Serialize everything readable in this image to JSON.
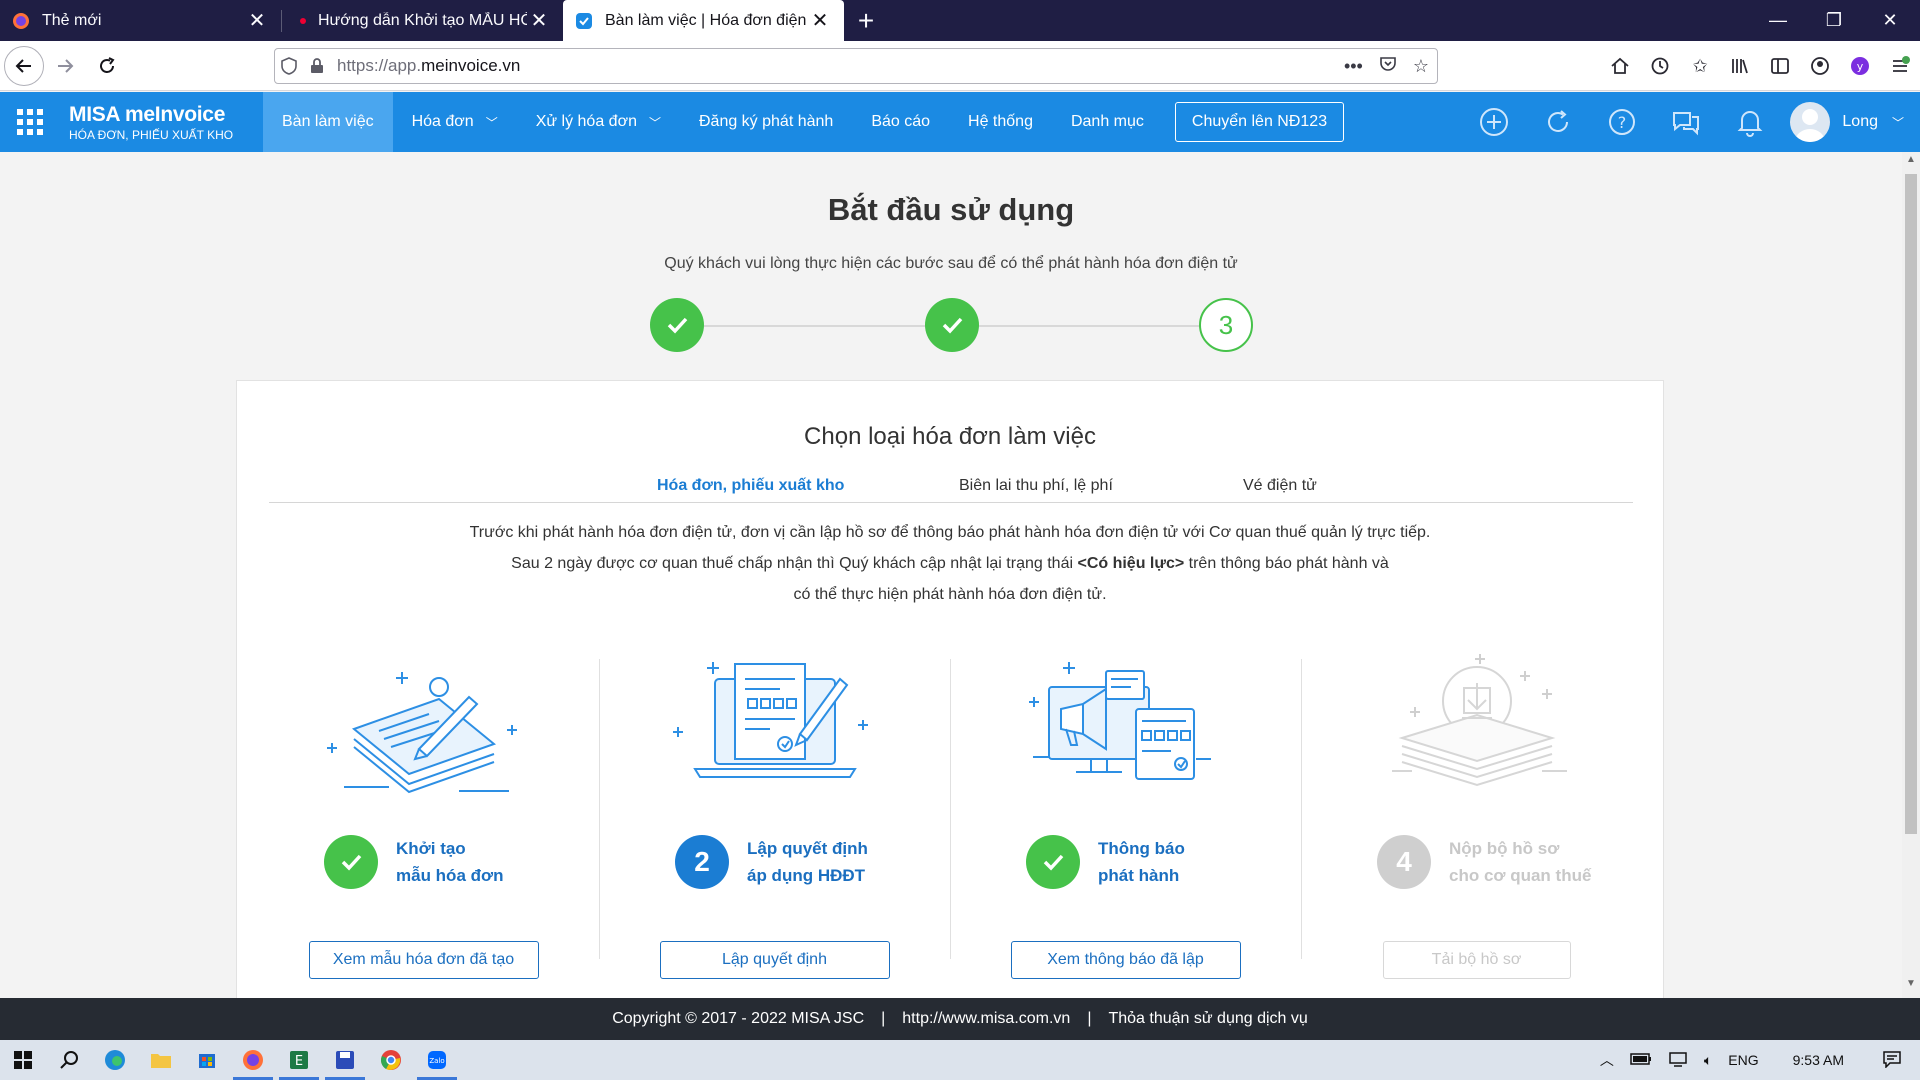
{
  "browser": {
    "tabs": [
      {
        "label": "Thẻ mới",
        "icon": "firefox-icon"
      },
      {
        "label": "Hướng dẫn Khởi tạo MẪU HÓA ĐƠN",
        "icon": "misa-dot-icon"
      },
      {
        "label": "Bàn làm việc | Hóa đơn điện tử",
        "icon": "meinvoice-icon",
        "active": true
      }
    ],
    "url_prefix": "https://app.",
    "url_domain": "meinvoice.vn"
  },
  "app": {
    "brand_name": "MISA meInvoice",
    "brand_tagline": "HÓA ĐƠN, PHIẾU XUẤT KHO",
    "menu": [
      {
        "label": "Bàn làm việc",
        "active": true,
        "dropdown": false
      },
      {
        "label": "Hóa đơn",
        "active": false,
        "dropdown": true
      },
      {
        "label": "Xử lý hóa đơn",
        "active": false,
        "dropdown": true
      },
      {
        "label": "Đăng ký phát hành",
        "active": false,
        "dropdown": false
      },
      {
        "label": "Báo cáo",
        "active": false,
        "dropdown": false
      },
      {
        "label": "Hệ thống",
        "active": false,
        "dropdown": false
      },
      {
        "label": "Danh mục",
        "active": false,
        "dropdown": false
      }
    ],
    "cta_label": "Chuyển lên NĐ123",
    "user_name": "Long",
    "brand_color": "#1b8ae3"
  },
  "page": {
    "title": "Bắt đầu sử dụng",
    "subtitle": "Quý khách vui lòng thực hiện các bước sau để có thể phát hành hóa đơn điện tử",
    "progress_step_current": "3",
    "card_title": "Chọn loại hóa đơn làm việc",
    "tabs": [
      {
        "label": "Hóa đơn, phiếu xuất kho",
        "active": true
      },
      {
        "label": "Biên lai thu phí, lệ phí",
        "active": false
      },
      {
        "label": "Vé điện tử",
        "active": false
      }
    ],
    "desc_line1": "Trước khi phát hành hóa đơn điện tử, đơn vị cần lập hồ sơ để thông báo phát hành hóa đơn điện tử với Cơ quan thuế quản lý trực tiếp.",
    "desc_line2_a": "Sau 2 ngày được cơ quan thuế chấp nhận thì Quý khách cập nhật lại trạng thái ",
    "desc_line2_b": "<Có hiệu lực>",
    "desc_line2_c": " trên thông báo phát hành và",
    "desc_line3": "có thể thực hiện phát hành hóa đơn điện tử.",
    "steps": [
      {
        "badge": "✓",
        "status": "done",
        "label": "Khởi tạo\nmẫu hóa đơn",
        "button": "Xem mẫu hóa đơn đã tạo"
      },
      {
        "badge": "2",
        "status": "current",
        "label": "Lập quyết định\náp dụng HĐĐT",
        "button": "Lập quyết định"
      },
      {
        "badge": "✓",
        "status": "done",
        "label": "Thông báo\nphát hành",
        "button": "Xem thông báo đã lập"
      },
      {
        "badge": "4",
        "status": "disabled",
        "label": "Nộp bộ hồ sơ\ncho cơ quan thuế",
        "button": "Tải bộ hồ sơ"
      }
    ]
  },
  "footer": {
    "copyright": "Copyright © 2017 - 2022 MISA JSC",
    "link": "http://www.misa.com.vn",
    "terms": "Thỏa thuận sử dụng dịch vụ"
  },
  "taskbar": {
    "lang": "ENG",
    "time": "9:53 AM"
  }
}
